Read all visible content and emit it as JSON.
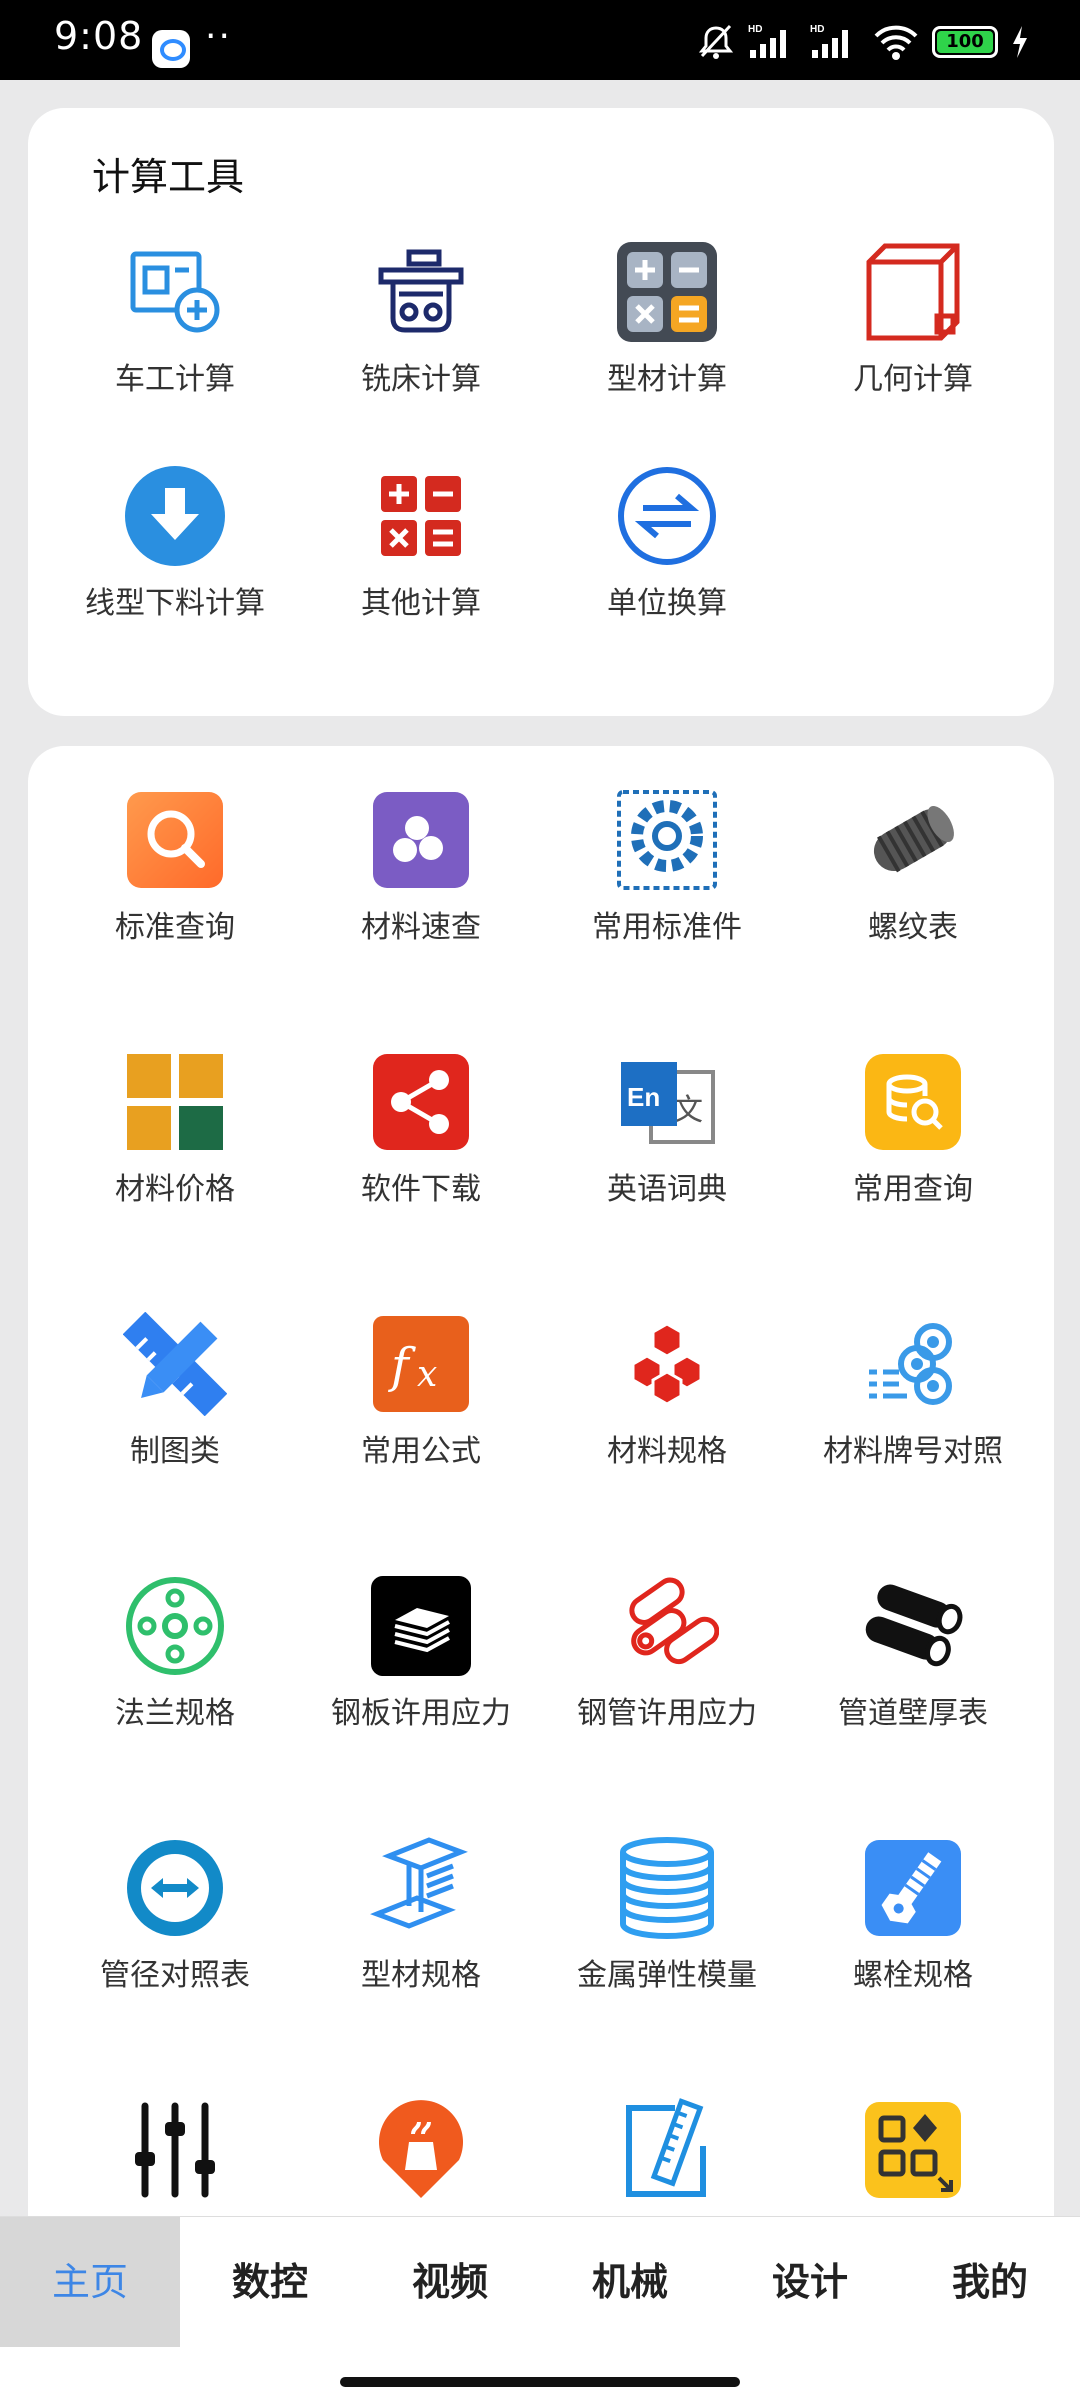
{
  "status_bar": {
    "time": "9:08",
    "battery": "100",
    "icons": [
      "app-icon",
      "mute-icon",
      "signal-hd-icon",
      "signal-hd-icon",
      "wifi-icon",
      "battery-icon",
      "charging-icon"
    ]
  },
  "calc_tools": {
    "title": "计算工具",
    "items": [
      {
        "label": "车工计算",
        "icon": "lathe-icon"
      },
      {
        "label": "铣床计算",
        "icon": "milling-icon"
      },
      {
        "label": "型材计算",
        "icon": "calculator-icon"
      },
      {
        "label": "几何计算",
        "icon": "cube-icon"
      },
      {
        "label": "线型下料计算",
        "icon": "download-circle-icon"
      },
      {
        "label": "其他计算",
        "icon": "math-ops-icon"
      },
      {
        "label": "单位换算",
        "icon": "convert-icon"
      }
    ]
  },
  "references": {
    "items": [
      {
        "label": "标准查询",
        "icon": "search-icon"
      },
      {
        "label": "材料速查",
        "icon": "material-icon"
      },
      {
        "label": "常用标准件",
        "icon": "gear-icon"
      },
      {
        "label": "螺纹表",
        "icon": "thread-icon"
      },
      {
        "label": "材料价格",
        "icon": "price-grid-icon"
      },
      {
        "label": "软件下载",
        "icon": "share-icon"
      },
      {
        "label": "英语词典",
        "icon": "dictionary-icon"
      },
      {
        "label": "常用查询",
        "icon": "database-search-icon"
      },
      {
        "label": "制图类",
        "icon": "drafting-icon"
      },
      {
        "label": "常用公式",
        "icon": "formula-icon"
      },
      {
        "label": "材料规格",
        "icon": "cubes-icon"
      },
      {
        "label": "材料牌号对照",
        "icon": "rolls-icon"
      },
      {
        "label": "法兰规格",
        "icon": "flange-icon"
      },
      {
        "label": "钢板许用应力",
        "icon": "steel-plate-icon"
      },
      {
        "label": "钢管许用应力",
        "icon": "steel-pipe-icon"
      },
      {
        "label": "管道壁厚表",
        "icon": "pipe-icon"
      },
      {
        "label": "管径对照表",
        "icon": "diameter-icon"
      },
      {
        "label": "型材规格",
        "icon": "i-beam-icon"
      },
      {
        "label": "金属弹性模量",
        "icon": "layers-icon"
      },
      {
        "label": "螺栓规格",
        "icon": "bolt-icon"
      },
      {
        "label": "",
        "icon": "sliders-icon"
      },
      {
        "label": "",
        "icon": "gas-icon"
      },
      {
        "label": "",
        "icon": "edit-ruler-icon"
      },
      {
        "label": "",
        "icon": "apps-icon"
      }
    ]
  },
  "bottom_nav": {
    "tabs": [
      "主页",
      "数控",
      "视频",
      "机械",
      "设计",
      "我的"
    ],
    "active": "主页"
  }
}
